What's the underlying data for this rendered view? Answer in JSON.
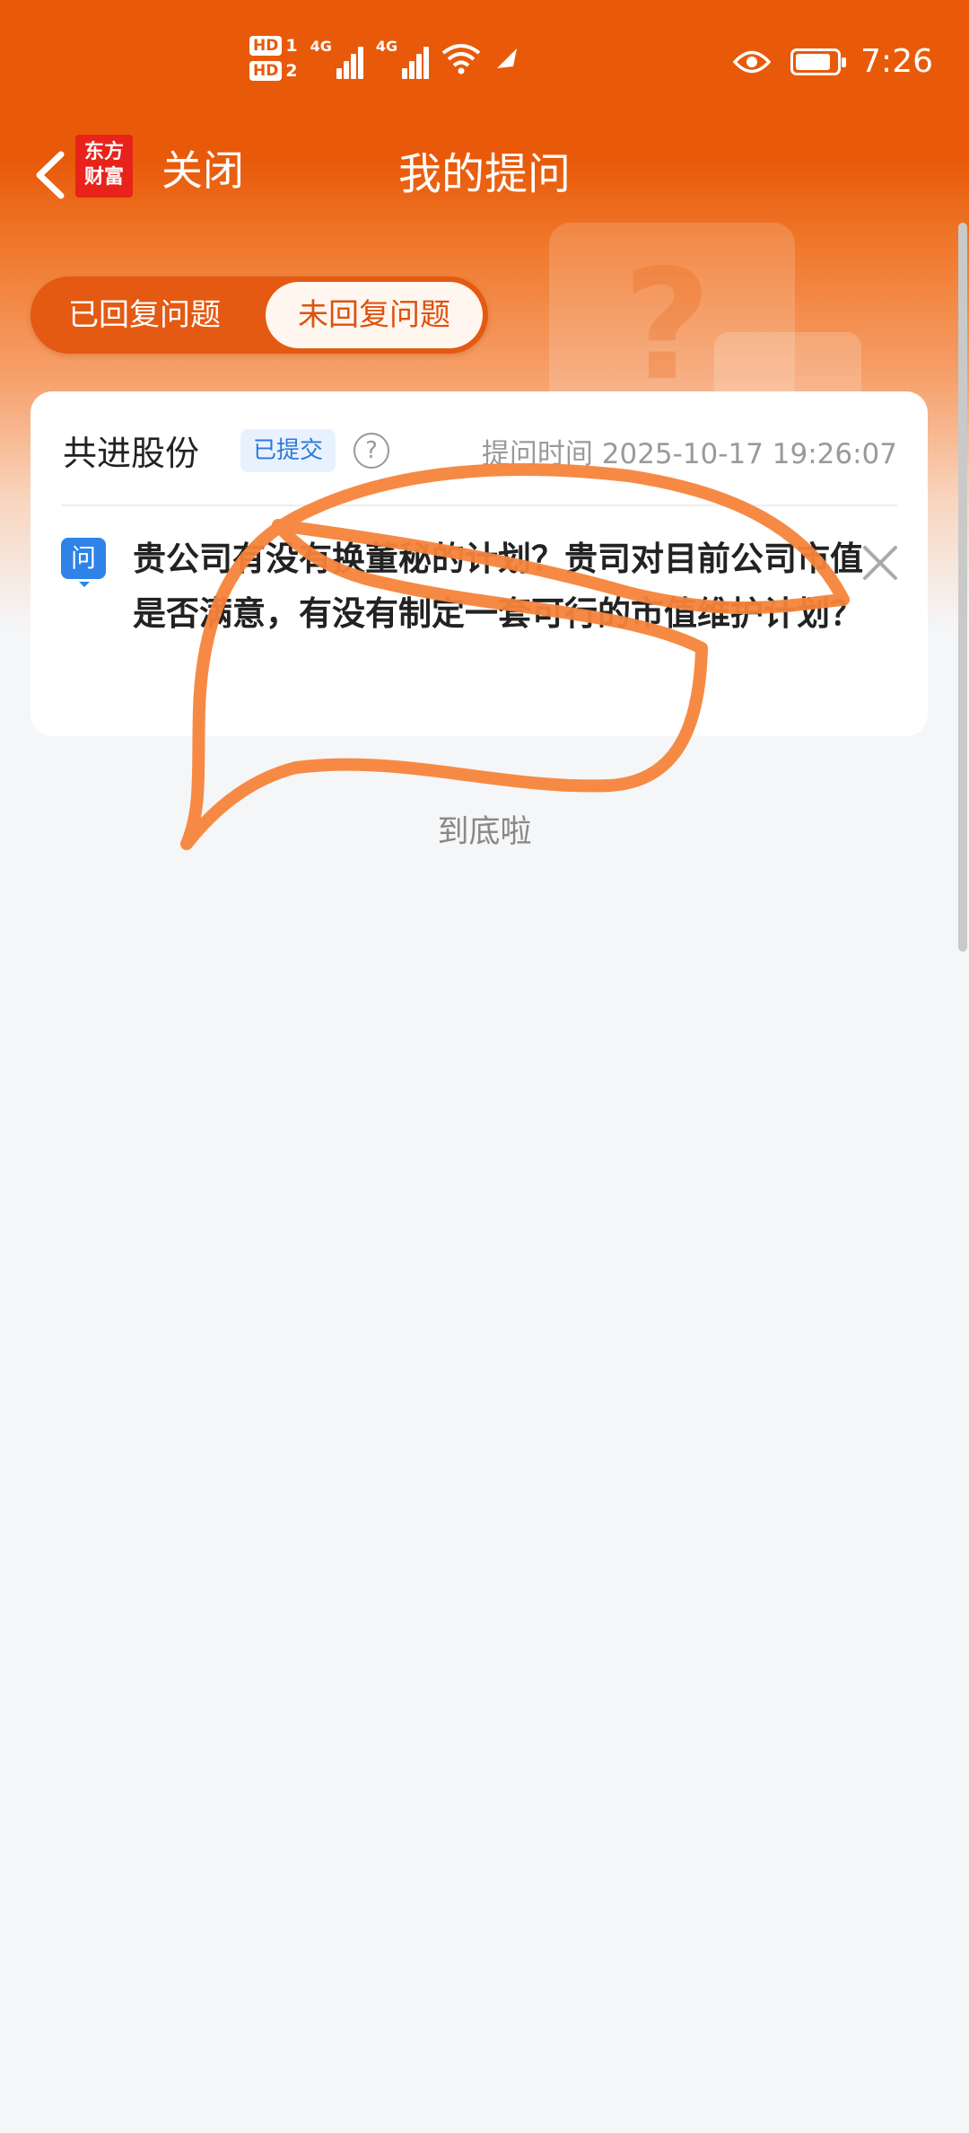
{
  "status_bar": {
    "hd1": "HD",
    "hd1_num": "1",
    "hd2": "HD",
    "hd2_num": "2",
    "sig1_label": "4G",
    "sig2_label": "4G",
    "time": "7:26",
    "icons": [
      "signal-icon",
      "wifi-icon",
      "eye-icon",
      "battery-icon"
    ]
  },
  "nav": {
    "logo_text_top": "东方",
    "logo_text_bottom": "财富",
    "close_label": "关闭",
    "title": "我的提问"
  },
  "tabs": [
    {
      "label": "已回复问题",
      "active": false
    },
    {
      "label": "未回复问题",
      "active": true
    }
  ],
  "question_card": {
    "stock_name": "共进股份",
    "status_badge": "已提交",
    "help_symbol": "?",
    "ask_time": "提问时间 2025-10-17 19:26:07",
    "q_icon_label": "问",
    "question_text": "贵公司有没有换董秘的计划？贵司对目前公司市值是否满意，有没有制定一套可行的市值维护计划？"
  },
  "list_end_text": "到底啦",
  "colors": {
    "brand_orange": "#e85a0a",
    "scribble": "#f5843a",
    "badge_blue": "#2f78d7"
  }
}
